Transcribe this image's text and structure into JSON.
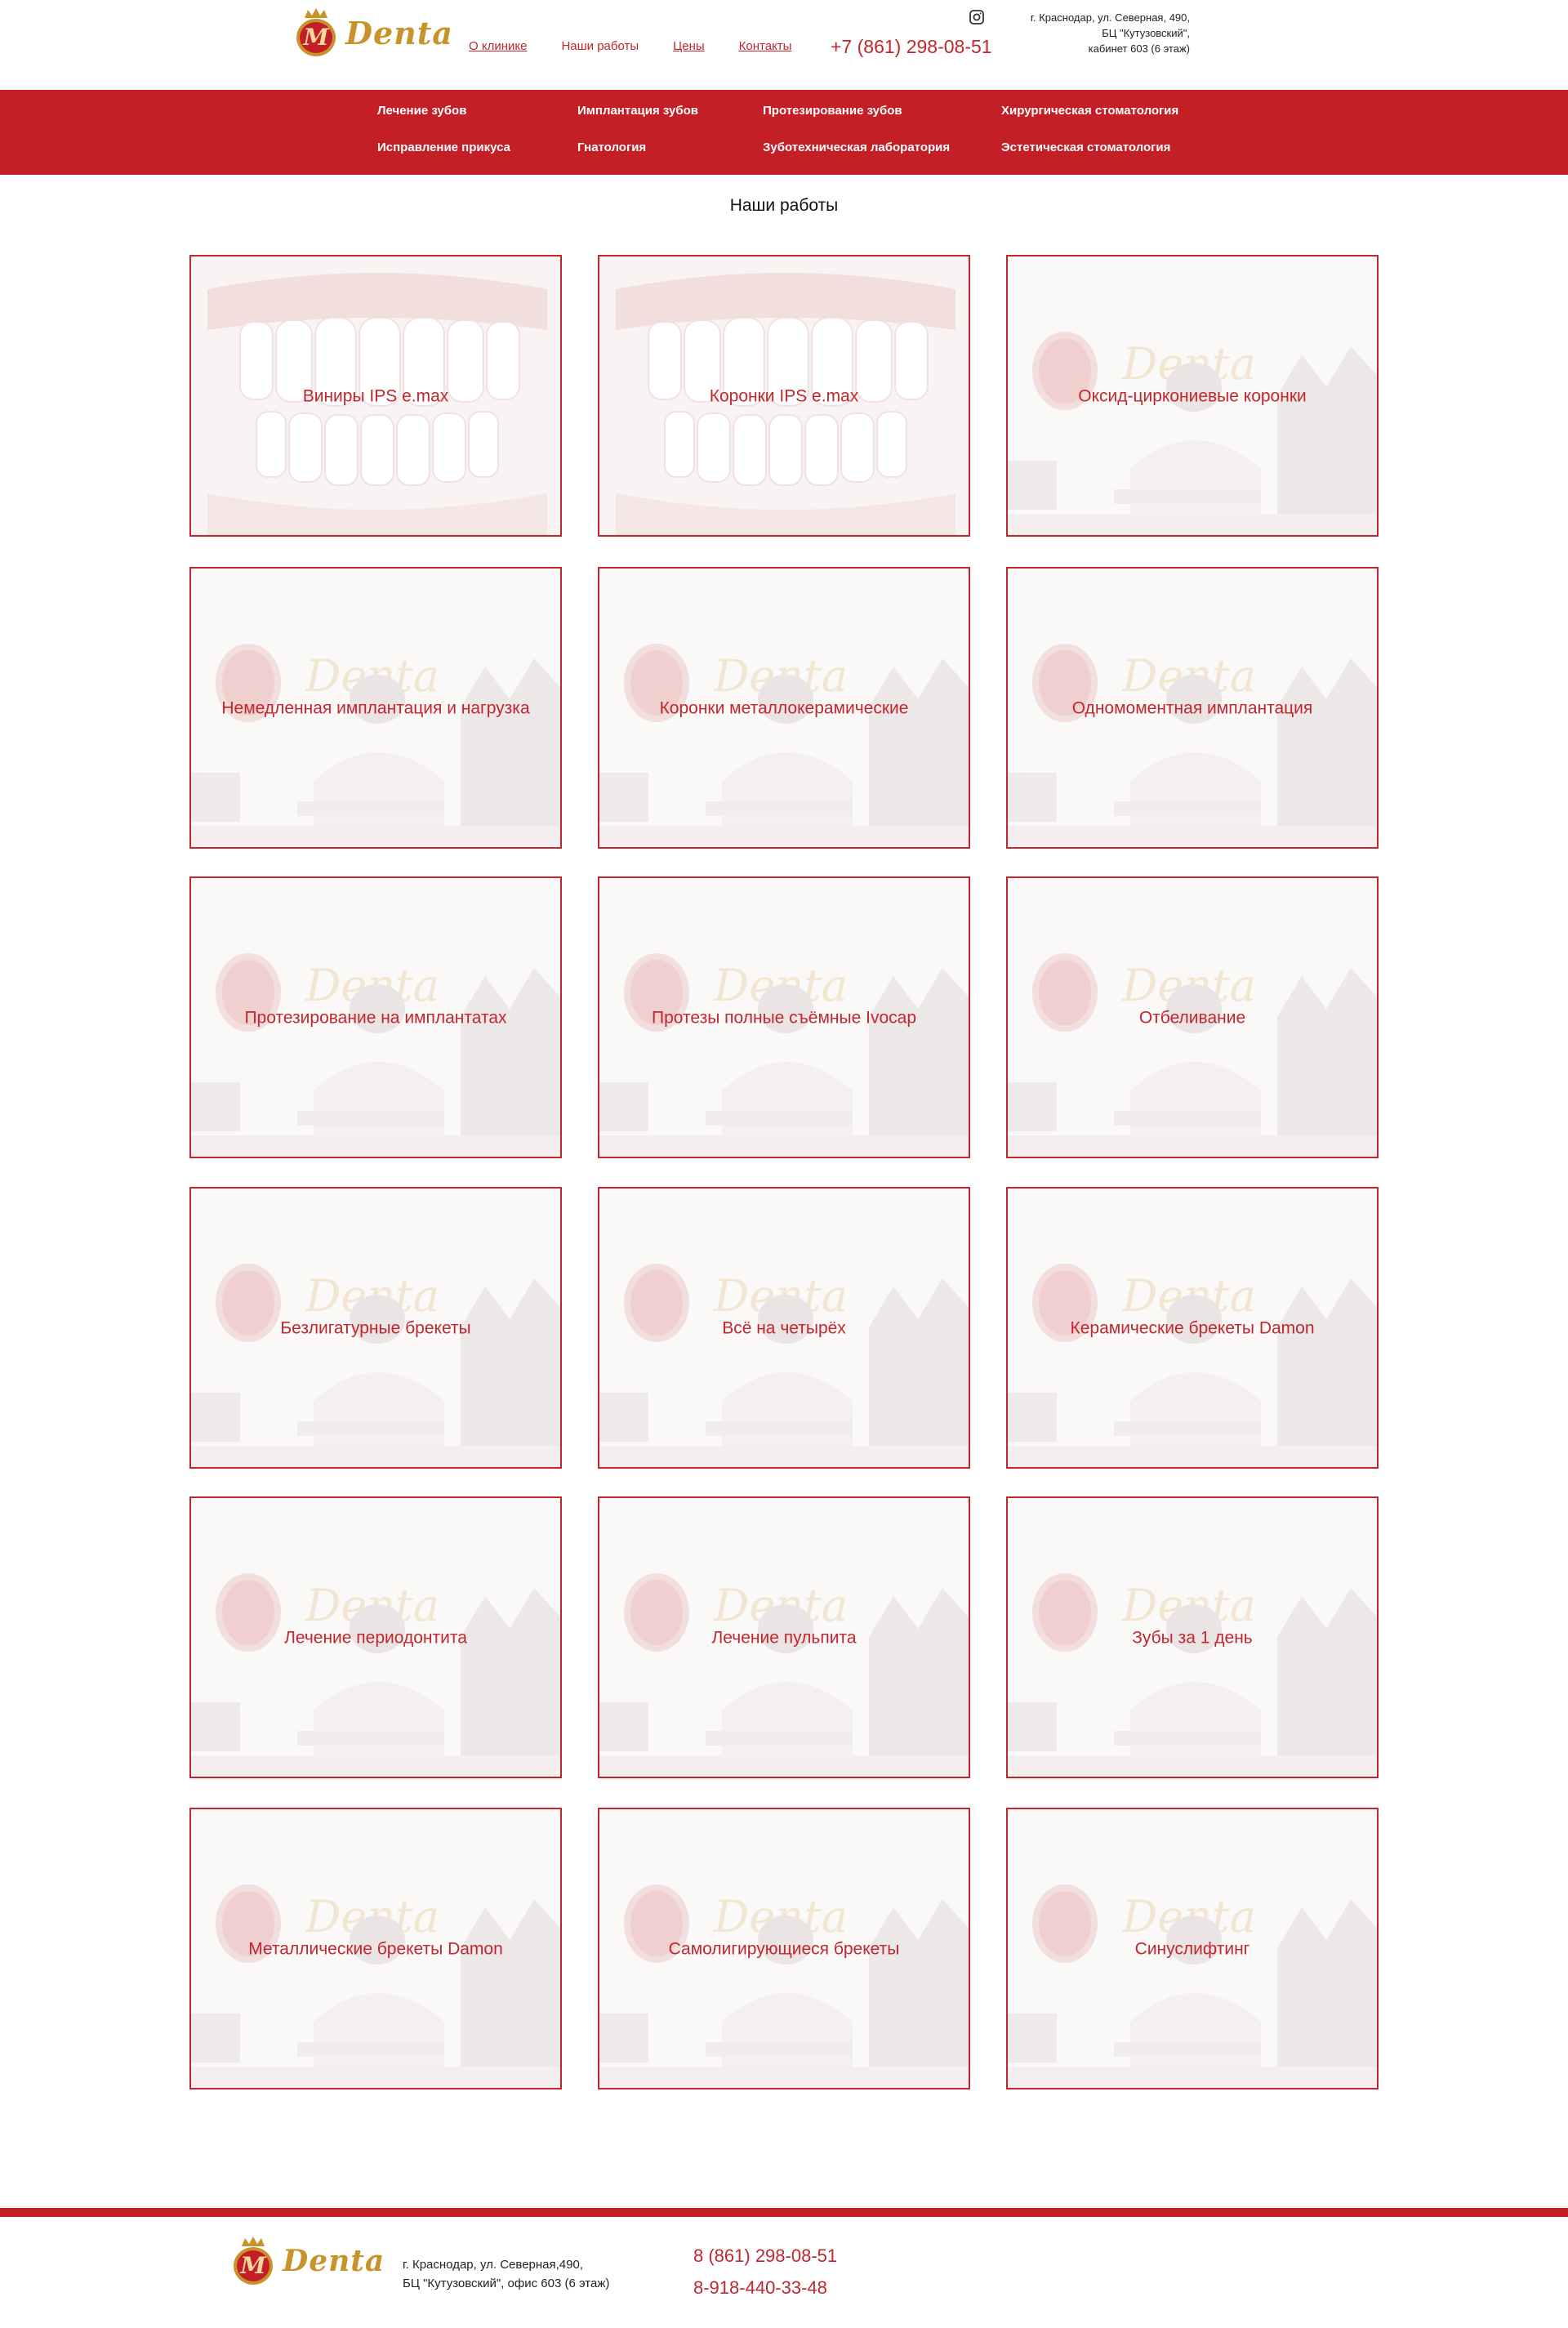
{
  "brand": {
    "logo_letter": "M",
    "logo_word": "Denta",
    "color_red": "#c41e26",
    "color_gold": "#c8932a"
  },
  "header": {
    "nav": [
      {
        "label": "О клинике"
      },
      {
        "label": "Наши работы"
      },
      {
        "label": "Цены"
      },
      {
        "label": "Контакты"
      }
    ],
    "phone": "+7 (861) 298-08-51",
    "social_icon": "instagram-icon",
    "address_lines": [
      "г. Краснодар, ул. Северная, 490,",
      "БЦ \"Кутузовский\",",
      "кабинет 603 (6 этаж)"
    ]
  },
  "menu": {
    "items": [
      "Лечение зубов",
      "Имплантация зубов",
      "Протезирование зубов",
      "Хирургическая стоматология",
      "Исправление прикуса",
      "Гнатология",
      "Зуботехническая лаборатория",
      "Эстетическая стоматология"
    ]
  },
  "page": {
    "title": "Наши работы"
  },
  "works": [
    {
      "label": "Виниры IPS e.max",
      "image": "teeth-photo"
    },
    {
      "label": "Коронки IPS e.max",
      "image": "teeth-photo"
    },
    {
      "label": "Оксид-циркониевые коронки",
      "image": "clinic-photo"
    },
    {
      "label": "Немедленная имплантация и нагрузка",
      "image": "clinic-photo"
    },
    {
      "label": "Коронки металлокерамические",
      "image": "clinic-photo"
    },
    {
      "label": "Одномоментная имплантация",
      "image": "clinic-photo"
    },
    {
      "label": "Протезирование на имплантатах",
      "image": "clinic-photo"
    },
    {
      "label": "Протезы полные съёмные Ivocap",
      "image": "clinic-photo"
    },
    {
      "label": "Отбеливание",
      "image": "clinic-photo"
    },
    {
      "label": "Безлигатурные брекеты",
      "image": "clinic-photo"
    },
    {
      "label": "Всё на четырёх",
      "image": "clinic-photo"
    },
    {
      "label": "Керамические брекеты Damon",
      "image": "clinic-photo"
    },
    {
      "label": "Лечение периодонтита",
      "image": "clinic-photo"
    },
    {
      "label": "Лечение пульпита",
      "image": "clinic-photo"
    },
    {
      "label": "Зубы за 1 день",
      "image": "clinic-photo"
    },
    {
      "label": "Металлические брекеты Damon",
      "image": "clinic-photo"
    },
    {
      "label": "Самолигирующиеся брекеты",
      "image": "clinic-photo"
    },
    {
      "label": "Синуслифтинг",
      "image": "clinic-photo"
    }
  ],
  "footer": {
    "address_lines": [
      "г. Краснодар, ул. Северная,490,",
      "БЦ \"Кутузовский\", офис 603 (6 этаж)"
    ],
    "phones": [
      "8 (861) 298-08-51",
      "8-918-440-33-48"
    ]
  }
}
